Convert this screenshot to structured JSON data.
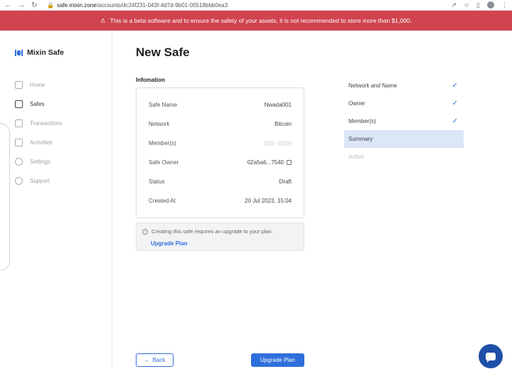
{
  "browser": {
    "url_host": "safe.mixin.zone",
    "url_path": "/accounts/dc24f231-043f-4d7d-9b01-05518bbb0ea3"
  },
  "banner": {
    "text": "This is a beta software and to ensure the safety of your assets, it is not recommended to store more than $1,000."
  },
  "sidebar": {
    "logo_text": "Mixin Safe",
    "items": [
      {
        "label": "Home",
        "icon": "home-icon"
      },
      {
        "label": "Safes",
        "icon": "safe-icon"
      },
      {
        "label": "Transactions",
        "icon": "transactions-icon"
      },
      {
        "label": "Activities",
        "icon": "activities-icon"
      },
      {
        "label": "Settings",
        "icon": "settings-icon"
      },
      {
        "label": "Support",
        "icon": "support-icon"
      }
    ]
  },
  "main": {
    "title": "New Safe",
    "section_label": "Infomation",
    "info": [
      {
        "label": "Safe Name",
        "value": "Nwada001"
      },
      {
        "label": "Network",
        "value": "Bitcoin"
      },
      {
        "label": "Member(s)",
        "value": ""
      },
      {
        "label": "Safe Owner",
        "value": "02a5a6...7540"
      },
      {
        "label": "Status",
        "value": "Draft"
      },
      {
        "label": "Created At",
        "value": "20 Jul 2023, 15:04"
      }
    ],
    "notice": {
      "text": "Creating this safe requires an upgrade to your plan.",
      "link": "Upgrade Plan"
    },
    "back_label": "Back",
    "upgrade_label": "Upgrade Plan"
  },
  "steps": [
    {
      "label": "Network and Name",
      "state": "done"
    },
    {
      "label": "Owner",
      "state": "done"
    },
    {
      "label": "Member(s)",
      "state": "done"
    },
    {
      "label": "Summary",
      "state": "current"
    },
    {
      "label": "Active",
      "state": "todo"
    }
  ],
  "colors": {
    "accent": "#2f6fdb",
    "banner": "#d0434f"
  }
}
